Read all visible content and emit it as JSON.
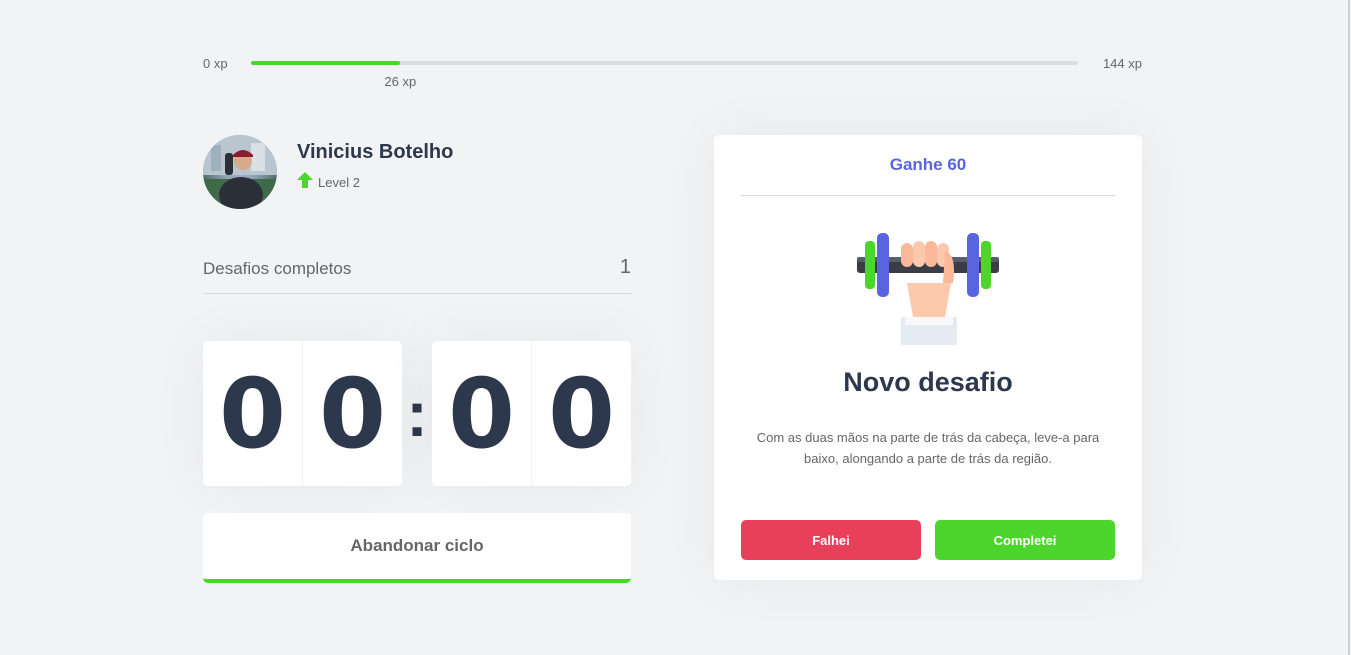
{
  "xp": {
    "min_label": "0 xp",
    "max_label": "144 xp",
    "current_label": "26 xp",
    "current": 26,
    "max": 144,
    "fill_color": "#4cd62b"
  },
  "profile": {
    "name": "Vinicius Botelho",
    "level_label": "Level 2",
    "level_icon": "arrow-up-icon"
  },
  "completed": {
    "label": "Desafios completos",
    "value": "1"
  },
  "countdown": {
    "minute_left": "0",
    "minute_right": "0",
    "separator": ":",
    "second_left": "0",
    "second_right": "0"
  },
  "abandon_button": "Abandonar ciclo",
  "challenge": {
    "header": "Ganhe 60",
    "icon": "dumbbell-icon",
    "title": "Novo desafio",
    "description": "Com as duas mãos na parte de trás da cabeça, leve-a para baixo, alongando a parte de trás da região.",
    "fail_button": "Falhei",
    "success_button": "Completei"
  },
  "colors": {
    "background": "#f2f3f5",
    "accent_blue": "#5965e0",
    "success_green": "#4cd62b",
    "fail_red": "#e83f5b",
    "title_dark": "#2e384d"
  }
}
